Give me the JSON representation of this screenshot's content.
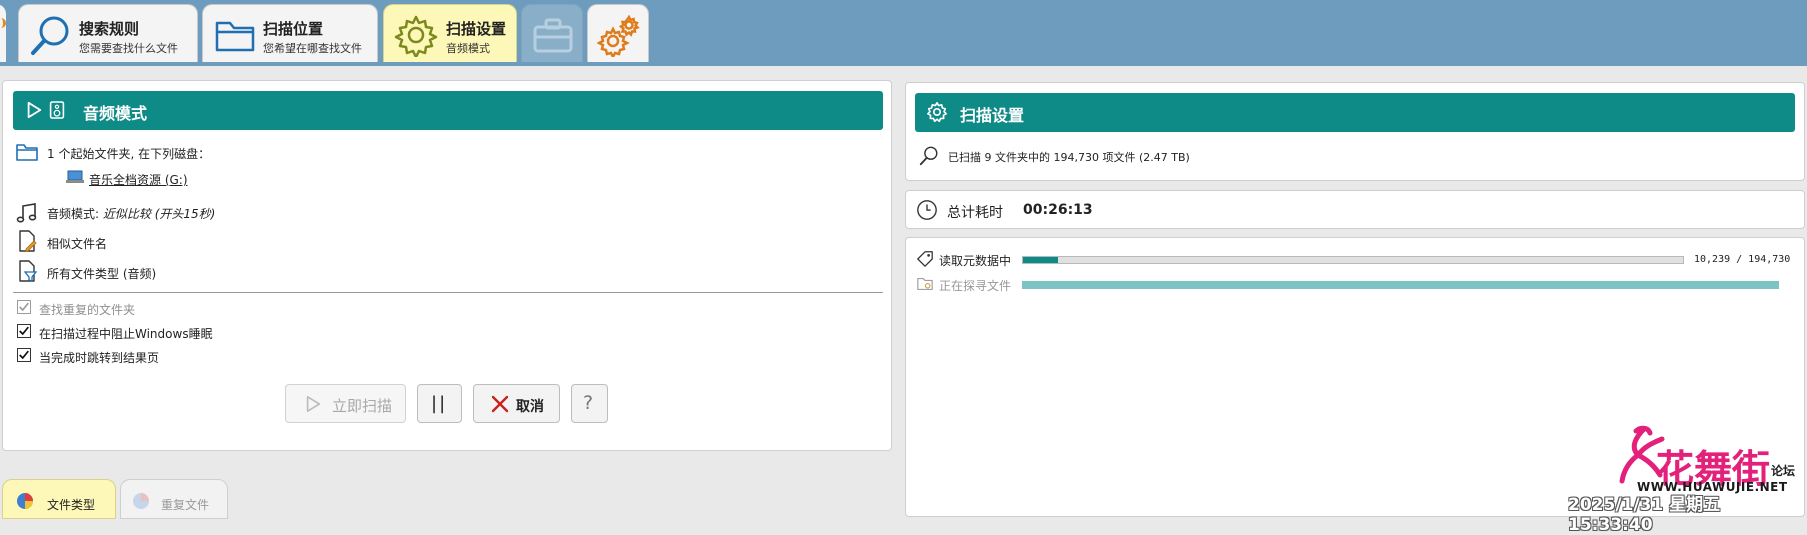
{
  "tabs": [
    {
      "title": "搜索规则",
      "subtitle": "您需要查找什么文件"
    },
    {
      "title": "扫描位置",
      "subtitle": "您希望在哪查找文件"
    },
    {
      "title": "扫描设置",
      "subtitle": "音频模式"
    }
  ],
  "left_panel": {
    "header": "音频模式",
    "source_line": "1 个起始文件夹, 在下列磁盘：",
    "drive": "音乐全档资源 (G:)",
    "audio_mode_label": "音频模式:",
    "audio_mode_value": "近似比较 (开头15秒)",
    "similar_names": "相似文件名",
    "file_types": "所有文件类型 (音频)",
    "options": [
      {
        "label": "查找重复的文件夹",
        "checked": true,
        "enabled": false
      },
      {
        "label": "在扫描过程中阻止Windows睡眠",
        "checked": true,
        "enabled": true
      },
      {
        "label": "当完成时跳转到结果页",
        "checked": true,
        "enabled": true
      }
    ],
    "buttons": {
      "scan_now": "立即扫描",
      "pause": "||",
      "cancel": "取消",
      "help": "?"
    }
  },
  "right_panel": {
    "header": "扫描设置",
    "scanned_summary": "已扫描 9 文件夹中的 194,730 项文件 (2.47 TB)",
    "elapsed_label": "总计耗时",
    "elapsed_value": "00:26:13",
    "progress": [
      {
        "label": "读取元数据中",
        "fraction": 0.0526,
        "count": "10,239 / 194,730",
        "active": true
      },
      {
        "label": "正在探寻文件",
        "fraction": 1.0,
        "count": "",
        "active": false
      }
    ]
  },
  "bottom_tabs": [
    {
      "label": "文件类型"
    },
    {
      "label": "重复文件"
    }
  ],
  "watermark": {
    "brand": "花舞街",
    "suffix": "论坛",
    "url": "WWW.HUAWUJIE.NET",
    "timestamp": "2025/1/31 星期五 15:33:40"
  },
  "colors": {
    "topbar": "#6d9cbf",
    "teal": "#0e8a87",
    "progress_light": "#7cc4c2",
    "active_tab": "#fdf7b8"
  }
}
